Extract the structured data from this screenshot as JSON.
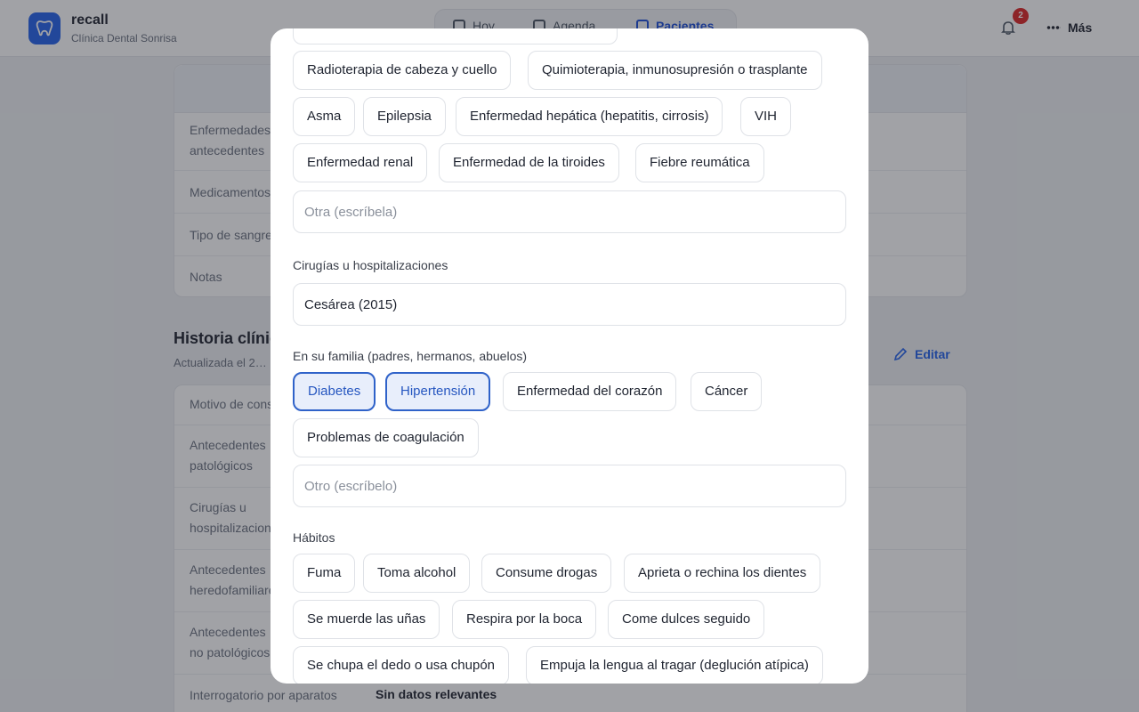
{
  "app": {
    "name": "recall",
    "clinic": "Clínica Dental Sonrisa",
    "nav": [
      "Hoy",
      "Agenda",
      "Pacientes"
    ],
    "notifications_count": "2",
    "more_label": "Más"
  },
  "background": {
    "rows_top": [
      "Enfermedades y antecedentes",
      "Medicamentos",
      "Tipo de sangre",
      "Notas"
    ],
    "history_title": "Historia clínica",
    "history_sub": "Actualizada el 2…",
    "edit_label": "Editar",
    "rows_history": [
      "Motivo de consulta",
      "Antecedentes patológicos",
      "Cirugías u hospitalizaciones",
      "Antecedentes heredofamiliares",
      "Antecedentes no patológicos",
      "Interrogatorio por aparatos"
    ],
    "interrogatorio_value": "Sin datos relevantes"
  },
  "modal": {
    "conditions_chips": [
      "Radioterapia de cabeza y cuello",
      "Quimioterapia, inmunosupresión o trasplante",
      "Asma",
      "Epilepsia",
      "Enfermedad hepática (hepatitis, cirrosis)",
      "VIH",
      "Enfermedad renal",
      "Enfermedad de la tiroides",
      "Fiebre reumática"
    ],
    "other_condition_placeholder": "Otra (escríbela)",
    "surgeries_label": "Cirugías u hospitalizaciones",
    "surgeries_value": "Cesárea (2015)",
    "family_label": "En su familia (padres, hermanos, abuelos)",
    "family_chips": [
      "Diabetes",
      "Hipertensión",
      "Enfermedad del corazón",
      "Cáncer",
      "Problemas de coagulación"
    ],
    "family_selected": [
      "Diabetes",
      "Hipertensión"
    ],
    "other_family_placeholder": "Otro (escríbelo)",
    "habits_label": "Hábitos",
    "habits_chips": [
      "Fuma",
      "Toma alcohol",
      "Consume drogas",
      "Aprieta o rechina los dientes",
      "Se muerde las uñas",
      "Respira por la boca",
      "Come dulces seguido",
      "Se chupa el dedo o usa chupón",
      "Empuja la lengua al tragar (deglución atípica)"
    ]
  },
  "colors": {
    "accent": "#2563eb",
    "chip_selected_bg": "#e8eefb",
    "chip_selected_border": "#2f62c9",
    "badge": "#dc2626"
  }
}
